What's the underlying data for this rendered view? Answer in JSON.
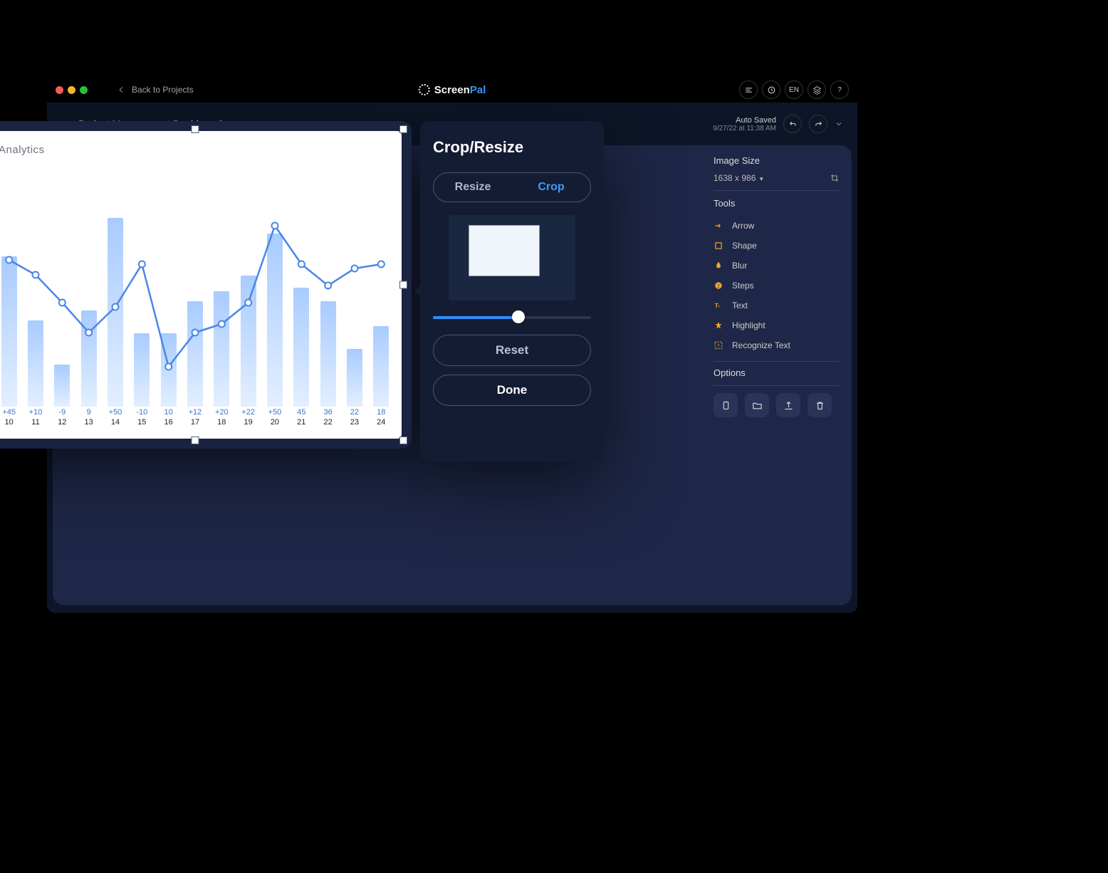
{
  "header": {
    "back_label": "Back to  Projects",
    "brand": "ScreenPal",
    "lang": "EN"
  },
  "subheader": {
    "project_title": "Project Management Dashboard",
    "autosave_label": "Auto Saved",
    "autosave_time": "9/27/22 at 11:38 AM"
  },
  "right_panel": {
    "image_size_title": "Image Size",
    "image_size_value": "1638 x 986",
    "tools_title": "Tools",
    "tools": [
      {
        "label": "Arrow"
      },
      {
        "label": "Shape"
      },
      {
        "label": "Blur"
      },
      {
        "label": "Steps"
      },
      {
        "label": "Text"
      },
      {
        "label": "Highlight"
      },
      {
        "label": "Recognize Text"
      }
    ],
    "options_title": "Options"
  },
  "dialog": {
    "title": "Crop/Resize",
    "tab_resize": "Resize",
    "tab_crop": "Crop",
    "reset": "Reset",
    "done": "Done",
    "slider_pct": 54
  },
  "chart_data": {
    "type": "bar+line",
    "title": "Analytics",
    "categories": [
      "10",
      "11",
      "12",
      "13",
      "14",
      "15",
      "16",
      "17",
      "18",
      "19",
      "20",
      "21",
      "22",
      "23",
      "24"
    ],
    "deltas": [
      "+45",
      "+10",
      "-9",
      "9",
      "+50",
      "-10",
      "10",
      "+12",
      "+20",
      "+22",
      "+50",
      "45",
      "36",
      "22",
      "18"
    ],
    "bar_values": [
      78,
      45,
      22,
      50,
      98,
      38,
      38,
      55,
      60,
      68,
      90,
      62,
      55,
      30,
      42
    ],
    "line_values": [
      62,
      55,
      42,
      28,
      40,
      60,
      12,
      28,
      32,
      42,
      78,
      60,
      50,
      58,
      60
    ],
    "ylim": [
      0,
      100
    ]
  }
}
